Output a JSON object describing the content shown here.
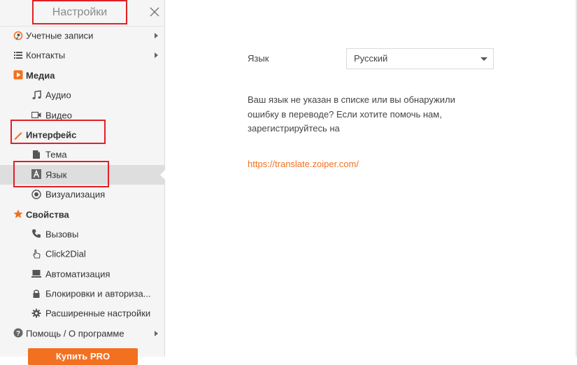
{
  "sidebar": {
    "title": "Настройки",
    "items": [
      {
        "label": "Учетные записи",
        "icon": "account-icon",
        "kind": "top",
        "arrow": true
      },
      {
        "label": "Контакты",
        "icon": "contacts-list-icon",
        "kind": "top",
        "arrow": true
      },
      {
        "label": "Медиа",
        "icon": "media-play-icon",
        "kind": "section"
      },
      {
        "label": "Аудио",
        "icon": "music-note-icon",
        "kind": "sub"
      },
      {
        "label": "Видео",
        "icon": "video-camera-icon",
        "kind": "sub"
      },
      {
        "label": "Интерфейс",
        "icon": "pencil-icon",
        "kind": "section"
      },
      {
        "label": "Тема",
        "icon": "theme-document-icon",
        "kind": "sub"
      },
      {
        "label": "Язык",
        "icon": "language-a-icon",
        "kind": "sub",
        "active": true
      },
      {
        "label": "Визуализация",
        "icon": "radio-target-icon",
        "kind": "sub"
      },
      {
        "label": "Свойства",
        "icon": "star-icon",
        "kind": "section"
      },
      {
        "label": "Вызовы",
        "icon": "phone-icon",
        "kind": "sub"
      },
      {
        "label": "Click2Dial",
        "icon": "hand-pointer-icon",
        "kind": "sub"
      },
      {
        "label": "Автоматизация",
        "icon": "laptop-icon",
        "kind": "sub"
      },
      {
        "label": "Блокировки и авториза...",
        "icon": "lock-icon",
        "kind": "sub"
      },
      {
        "label": "Расширенные настройки",
        "icon": "gear-icon",
        "kind": "sub"
      },
      {
        "label": "Помощь / О программе",
        "icon": "help-icon",
        "kind": "top",
        "arrow": true
      }
    ],
    "upgrade_label": "Купить PRO"
  },
  "main": {
    "language_label": "Язык",
    "language_value": "Русский",
    "help_text": "Ваш язык не указан в списке или вы обнаружили ошибку в переводе? Если хотите помочь нам, зарегистрируйтесь на",
    "link": "https://translate.zoiper.com/"
  },
  "colors": {
    "accent": "#f37021",
    "highlight_box": "#e41e26",
    "sidebar_bg": "#f5f5f5",
    "active_item_bg": "#dedede"
  }
}
